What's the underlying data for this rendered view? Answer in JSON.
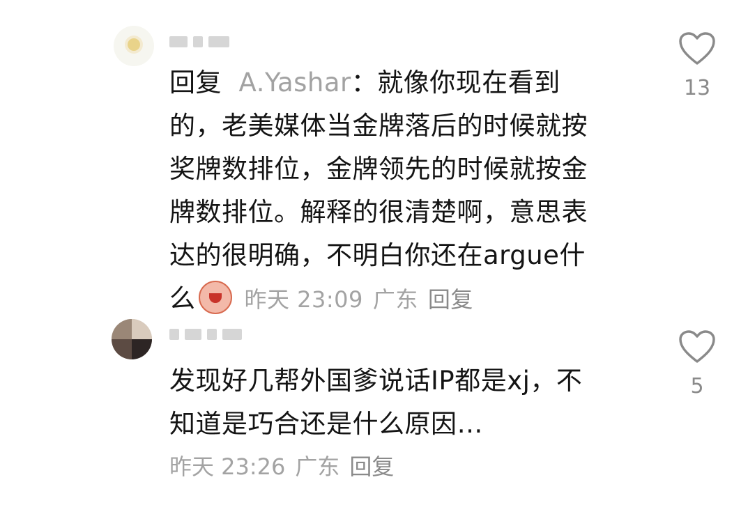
{
  "comments": [
    {
      "reply_prefix": "回复",
      "reply_to": "A.Yashar",
      "reply_colon": "：",
      "lines": [
        "就像你现在看到",
        "的，老美媒体当金牌落后的时候就按",
        "奖牌数排位，金牌领先的时候就按金",
        "牌数排位。解释的很清楚啊，意思表",
        "达的很明确，不明白你还在argue什",
        "么"
      ],
      "emoji_icon": "crying-face-sticker-icon",
      "time": "昨天 23:09",
      "location": "广东",
      "reply_label": "回复",
      "likes": "13"
    },
    {
      "lines": [
        "发现好几帮外国爹说话IP都是xj，不",
        "知道是巧合还是什么原因…"
      ],
      "time": "昨天 23:26",
      "location": "广东",
      "reply_label": "回复",
      "likes": "5"
    }
  ],
  "icons": {
    "like": "heart-outline-icon"
  },
  "colors": {
    "text": "#141414",
    "meta": "#a3a3a3",
    "reply_to": "#a2a2a2",
    "heart": "#8a8a8a"
  }
}
